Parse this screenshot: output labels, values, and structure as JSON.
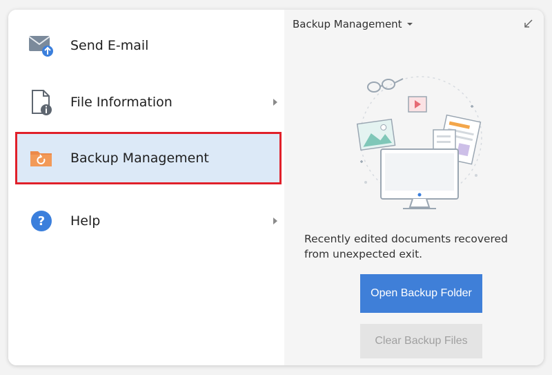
{
  "menu": {
    "items": [
      {
        "label": "Send E-mail",
        "icon": "email-upload-icon",
        "has_submenu": false
      },
      {
        "label": "File Information",
        "icon": "file-info-icon",
        "has_submenu": true
      },
      {
        "label": "Backup Management",
        "icon": "backup-folder-icon",
        "has_submenu": false,
        "selected": true
      },
      {
        "label": "Help",
        "icon": "help-icon",
        "has_submenu": true
      }
    ]
  },
  "panel": {
    "title": "Backup Management",
    "description": "Recently edited documents recovered from unexpected exit.",
    "open_button_label": "Open Backup Folder",
    "clear_button_label": "Clear Backup Files",
    "collapse_icon": "collapse-arrow-icon"
  },
  "colors": {
    "selected_bg": "#dce9f7",
    "selected_border": "#e0202a",
    "primary_button": "#3f7fd8",
    "disabled_button": "#e4e4e4",
    "help_icon": "#3b7fdc",
    "backup_icon": "#ec8a4a"
  }
}
